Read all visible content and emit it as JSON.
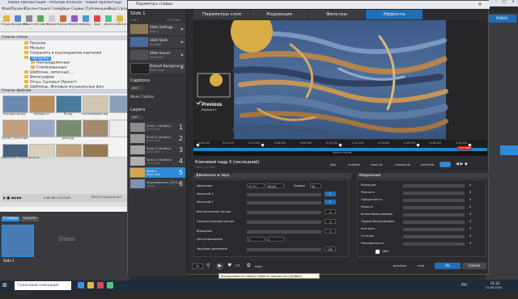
{
  "app": {
    "title": "Новая презентация - ProShow Producer - Новая презентация",
    "menu": [
      "Файл",
      "Правка",
      "Презентация",
      "Слайд",
      "Звук",
      "Сервис",
      "Публикация",
      "Вид",
      "Справка"
    ],
    "toolbar": [
      "Открыть",
      "Сохранить",
      "Печать",
      "Вставить",
      "Новый",
      "Выбрать",
      "Эффекты",
      "Слайд",
      "Звук",
      "Далее",
      "Шаблон"
    ],
    "sections": {
      "folders": "Список папок",
      "files": "Список файлов",
      "preview": "Область просмотра"
    },
    "folders": [
      "Рисунки",
      "Музыка",
      "Сохранить в кэш/недавние картинки",
      "Загрузки",
      "Неопределенные",
      "Стилизованные",
      "Шаблоны, запасные, ...",
      "Фотографии",
      "Отцы, Сыновья (Эрнест)",
      "Шаблоны, Фоновые музыкальные фон"
    ],
    "selected_folder": "Загрузки",
    "files": [
      "background.jpg",
      "desktop.ini",
      "ffc.jpg",
      "file.ico",
      "mainwallpaper.jpg",
      "mainBlueprint.png",
      "image.gif",
      "sky.jpg",
      "Dj1080_2016.mp3",
      "...",
      "grad.jpg",
      "...",
      "photo.jpg",
      "...",
      "digital-art.jpg",
      "...",
      "ffmoves_fanfare.wav",
      "...",
      "fgf.jpg",
      "...",
      "..."
    ],
    "player": {
      "time": "0:00.00 / 0:23.00",
      "extra": "7691253 mb/pcpdf.mp4"
    },
    "timeline_tabs": [
      "Слайды",
      "Шкала"
    ],
    "slide_caption": "Slide 1",
    "slide_subtitle": "Slides",
    "taskbar_search": "Голосовой помощник Алиса",
    "clock": "21:22",
    "date": "21.05.2024",
    "lang": "РУС",
    "right_label": "PUBLIS"
  },
  "dialog": {
    "title": "Параметры слайда",
    "tabs": [
      "Параметры слоя",
      "Коррекция",
      "Фильтры",
      "Эффекты"
    ],
    "active_tab": "Эффекты",
    "slide_header": "Slide 1",
    "slide_duration": "23.0 secs",
    "slide_count": "1 of 1",
    "slide_items": [
      {
        "title": "Slide Settings",
        "sub": "Slide 1",
        "color": "#8a7a55"
      },
      {
        "title": "Slide Style",
        "sub": "No Style",
        "color": "#4a6a9a"
      },
      {
        "title": "Slide Sound",
        "sub": "No Sound",
        "color": "#4e4e56"
      },
      {
        "title": "Default Background",
        "sub": "Solid Color",
        "color": "#222"
      }
    ],
    "captions_header": "Captions",
    "captions_add": "add",
    "caption_item": "Blank Caption",
    "layers_header": "Layers",
    "layers_add": "add",
    "layers": [
      {
        "title": "Solid 1 (Hidden)",
        "sub": "Solid Color",
        "num": "1",
        "color": "#8c8c8c"
      },
      {
        "title": "Solid 2 (Hidden)",
        "sub": "Solid Color",
        "num": "2",
        "color": "#9a9a9a"
      },
      {
        "title": "Solid 3 (Hidden)",
        "sub": "Solid Color",
        "num": "3",
        "color": "#a5a5a5"
      },
      {
        "title": "Solid 4 (Hidden)",
        "sub": "Solid Color",
        "num": "4",
        "color": "#b0b0b0"
      },
      {
        "title": "Solid 1",
        "sub": "Solid Color",
        "num": "5",
        "color": "#d2a64a"
      },
      {
        "title": "depositphotos_4578...",
        "sub": "Image",
        "num": "6",
        "color": "#7d93b3"
      }
    ],
    "selected_layer_index": 4,
    "preview_caption": "Previous",
    "preview_subcaption": "Keyframe 4",
    "ruler_ticks": [
      "0:00.000",
      "0:02.000",
      "0:04.000",
      "0:06.000",
      "0:08.000",
      "0:10.000",
      "0:12.000",
      "0:14.000",
      "0:16.000",
      "0:18.000",
      "0:20.000",
      "0:22.000"
    ],
    "ruler_label": "Время слайда",
    "ruler_marker": "0:21.596",
    "keyframe_title": "Ключевой кадр 5 (последний)",
    "keyframe_sub": "Time 0:21.596",
    "kf_buttons": [
      "add",
      "multiple",
      "reset all",
      "remove all",
      "add time"
    ],
    "motion_header": "Движение и звук",
    "motion_rows": [
      {
        "label": "Движение",
        "v1": "47.57",
        "v2": "48.81",
        "v3": "0",
        "v3_label": "Кривая",
        "v4": "50"
      },
      {
        "label": "Масштаб X",
        "v1": "0"
      },
      {
        "label": "Масштаб Y",
        "v1": "0"
      },
      {
        "label": "Вертикальный наклон",
        "v1": "0"
      },
      {
        "label": "Горизонтальный наклон",
        "v1": "0"
      },
      {
        "label": "Вращение",
        "v1": "0"
      },
      {
        "label": "Центр вращения",
        "v1": "0",
        "v2": "0"
      },
      {
        "label": "Звуковое движение",
        "v1": "100"
      }
    ],
    "correction_header": "Коррекция",
    "correction_rows": [
      {
        "label": "Размытие",
        "v": "0"
      },
      {
        "label": "Резкость",
        "v": "0"
      },
      {
        "label": "Прозрачность",
        "v": "0"
      },
      {
        "label": "Яркость",
        "v": "0"
      },
      {
        "label": "Белая балансировка",
        "v": "0"
      },
      {
        "label": "Черная балансировка",
        "v": "0"
      },
      {
        "label": "Контраст",
        "v": "0"
      },
      {
        "label": "Оттенок",
        "v": "0"
      },
      {
        "label": "Насыщенность",
        "v": "0"
      }
    ],
    "color_label": "Цвет",
    "bottom": {
      "zoom": "75",
      "tooltip": "Воспроизвести слайд в области просмотра (Пробел)",
      "copy_label": "copy",
      "previous": "previous",
      "next": "next",
      "ok": "Ok",
      "cancel": "Cancel"
    }
  },
  "colors": {
    "accent": "#1f6fb8",
    "selected": "#2f8ad8",
    "playhead": "#d92323"
  }
}
